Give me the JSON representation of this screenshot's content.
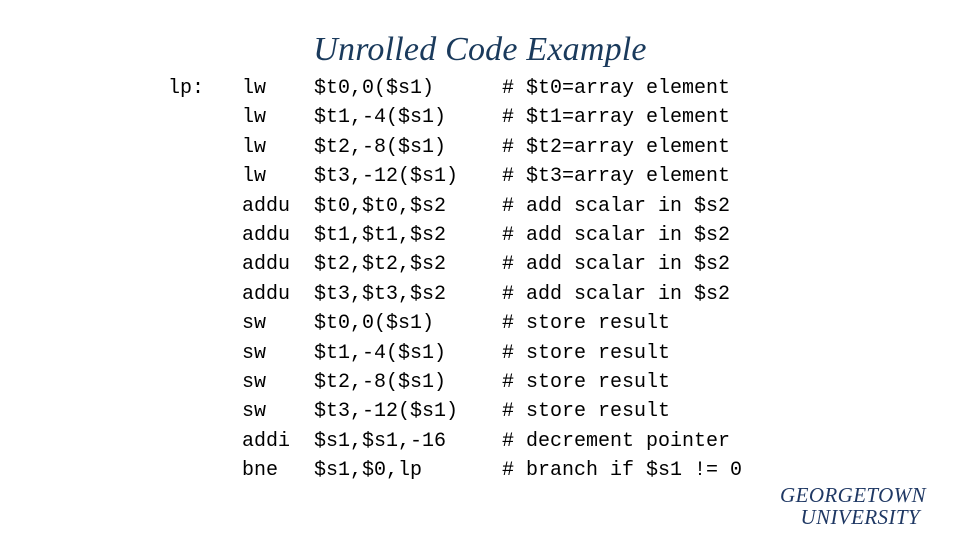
{
  "slide": {
    "title": "Unrolled Code Example",
    "title_color": "#1A3A5C",
    "background_color": "#ffffff",
    "code_color": "#000000"
  },
  "code": {
    "lines": [
      {
        "label": "lp:",
        "mnemonic": "lw",
        "operands": "$t0,0($s1)",
        "comment": "# $t0=array element"
      },
      {
        "label": "",
        "mnemonic": "lw",
        "operands": "$t1,-4($s1)",
        "comment": "# $t1=array element"
      },
      {
        "label": "",
        "mnemonic": "lw",
        "operands": "$t2,-8($s1)",
        "comment": "# $t2=array element"
      },
      {
        "label": "",
        "mnemonic": "lw",
        "operands": "$t3,-12($s1)",
        "comment": "# $t3=array element"
      },
      {
        "label": "",
        "mnemonic": "addu",
        "operands": "$t0,$t0,$s2",
        "comment": "# add scalar in $s2"
      },
      {
        "label": "",
        "mnemonic": "addu",
        "operands": "$t1,$t1,$s2",
        "comment": "# add scalar in $s2"
      },
      {
        "label": "",
        "mnemonic": "addu",
        "operands": "$t2,$t2,$s2",
        "comment": "# add scalar in $s2"
      },
      {
        "label": "",
        "mnemonic": "addu",
        "operands": "$t3,$t3,$s2",
        "comment": "# add scalar in $s2"
      },
      {
        "label": "",
        "mnemonic": "sw",
        "operands": "$t0,0($s1)",
        "comment": "# store result"
      },
      {
        "label": "",
        "mnemonic": "sw",
        "operands": "$t1,-4($s1)",
        "comment": "# store result"
      },
      {
        "label": "",
        "mnemonic": "sw",
        "operands": "$t2,-8($s1)",
        "comment": "# store result"
      },
      {
        "label": "",
        "mnemonic": "sw",
        "operands": "$t3,-12($s1)",
        "comment": "# store result"
      },
      {
        "label": "",
        "mnemonic": "addi",
        "operands": "$s1,$s1,-16",
        "comment": "# decrement pointer"
      },
      {
        "label": "",
        "mnemonic": "bne",
        "operands": "$s1,$0,lp",
        "comment": "# branch if $s1 != 0"
      }
    ]
  },
  "logo": {
    "line1": "GEORGETOWN",
    "line2": "UNIVERSITY",
    "color": "#1F3864"
  }
}
